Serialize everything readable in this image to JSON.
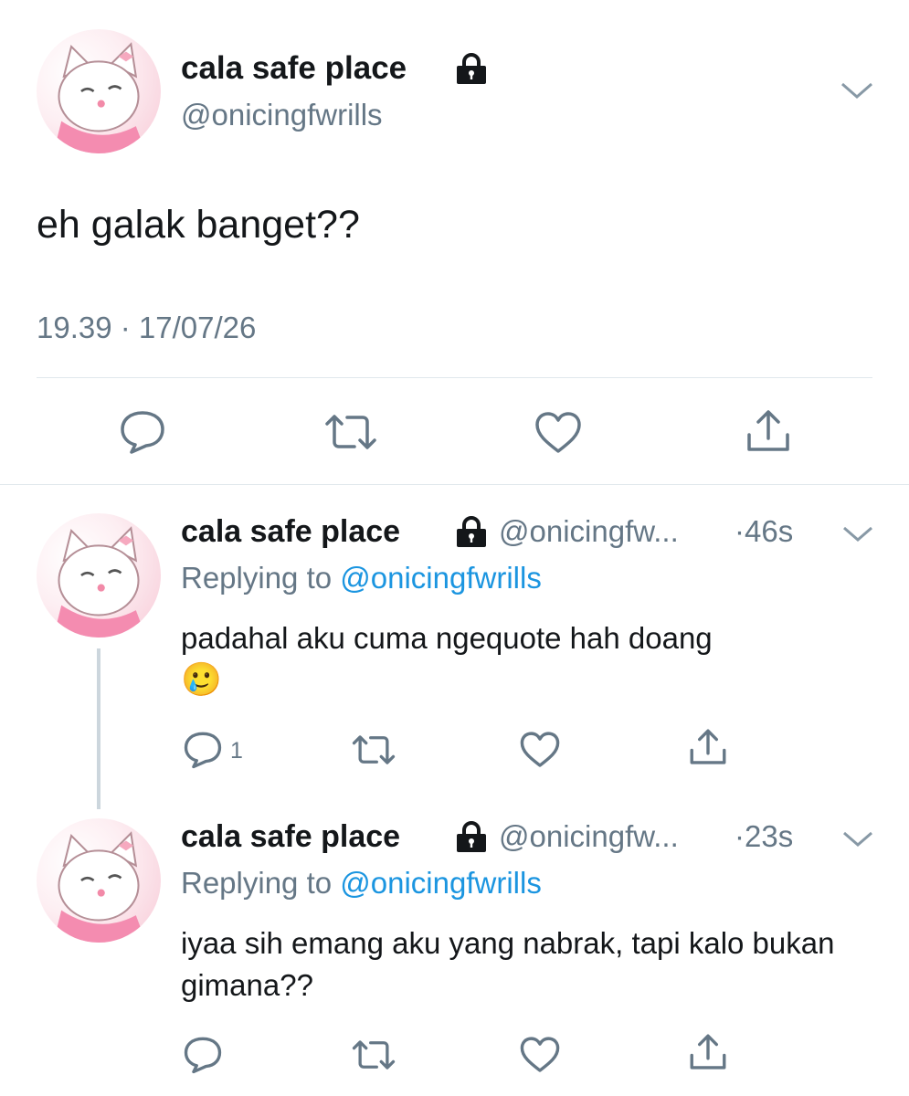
{
  "main_tweet": {
    "display_name": "cala safe place",
    "handle": "@onicingfwrills",
    "lock_icon": "lock-icon",
    "text": "eh galak banget??",
    "timestamp": "19.39 · 17/07/26",
    "actions": [
      "reply-icon",
      "retweet-icon",
      "like-icon",
      "share-icon"
    ]
  },
  "replies": [
    {
      "display_name": "cala safe place",
      "handle": "@onicingfw...",
      "time": "·46s",
      "replying_prefix": "Replying to ",
      "replying_to": "@onicingfwrills",
      "text": "padahal aku cuma ngequote hah doang",
      "emoji": "🥲",
      "reply_count": "1"
    },
    {
      "display_name": "cala safe place",
      "handle": "@onicingfw...",
      "time": "·23s",
      "replying_prefix": "Replying to ",
      "replying_to": "@onicingfwrills",
      "text": "iyaa sih emang aku yang nabrak, tapi kalo bukan gimana??",
      "reply_count": ""
    }
  ],
  "colors": {
    "text": "#14171a",
    "secondary": "#657786",
    "link": "#1b95e0",
    "divider": "#e1e8ed"
  }
}
